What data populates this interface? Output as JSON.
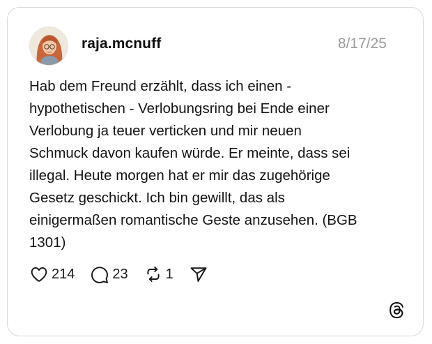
{
  "post": {
    "username": "raja.mcnuff",
    "date": "8/17/25",
    "text": "Hab dem Freund erzählt, dass ich einen -\nhypothetischen - Verlobungsring bei Ende einer\nVerlobung ja teuer verticken und mir neuen\nSchmuck davon kaufen würde. Er meinte, dass sei\nillegal. Heute morgen hat er mir das zugehörige\nGesetz geschickt. Ich bin gewillt, das als\neinigermaßen romantische Geste anzusehen. (BGB\n1301)"
  },
  "actions": {
    "likes": "214",
    "replies": "23",
    "reposts": "1",
    "like_icon": "heart-icon",
    "reply_icon": "speech-bubble-icon",
    "repost_icon": "repost-icon",
    "share_icon": "send-icon"
  },
  "branding": {
    "logo_icon": "threads-logo-icon"
  },
  "colors": {
    "text": "#141414",
    "muted": "#9a9a9a",
    "border": "#d9d9d9",
    "background": "#ffffff"
  }
}
